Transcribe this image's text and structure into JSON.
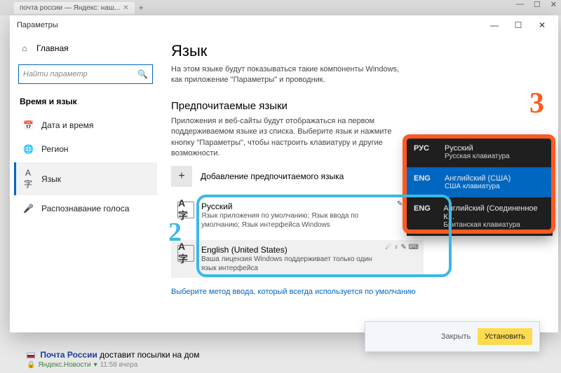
{
  "browser": {
    "tab_title": "почта россии — Яндекс: наш...",
    "controls": {
      "min": "—",
      "max": "☐",
      "close": "✕"
    }
  },
  "window": {
    "title": "Параметры",
    "controls": {
      "min": "—",
      "max": "☐",
      "close": "✕"
    }
  },
  "sidebar": {
    "home": "Главная",
    "search_placeholder": "Найти параметр",
    "section": "Время и язык",
    "items": [
      {
        "icon": "📅",
        "label": "Дата и время"
      },
      {
        "icon": "🌐",
        "label": "Регион"
      },
      {
        "icon": "A字",
        "label": "Язык"
      },
      {
        "icon": "🎤",
        "label": "Распознавание голоса"
      }
    ]
  },
  "content": {
    "title": "Язык",
    "desc": "На этом языке будут показываться такие компоненты Windows, как приложение \"Параметры\" и проводник.",
    "pref_title": "Предпочитаемые языки",
    "pref_desc": "Приложения и веб-сайты будут отображаться на первом поддерживаемом языке из списка. Выберите язык и нажмите кнопку \"Параметры\", чтобы настроить клавиатуру и другие возможности.",
    "add_label": "Добавление предпочитаемого языка",
    "langs": [
      {
        "glyph": "A字",
        "name": "Русский",
        "sub": "Язык приложения по умолчанию; Язык ввода по умолчанию; Язык интерфейса Windows",
        "icons": "✎ ♀ 🖵"
      },
      {
        "glyph": "A字",
        "name": "English (United States)",
        "sub": "Ваша лицензия Windows поддерживает только один язык интерфейса",
        "icons": "☄ ♀ ✎ ⌨"
      }
    ],
    "link": "Выберите метод ввода, который всегда используется по умолчанию"
  },
  "ime": {
    "rows": [
      {
        "code": "РУС",
        "l1": "Русский",
        "l2": "Русская клавиатура"
      },
      {
        "code": "ENG",
        "l1": "Английский (США)",
        "l2": "США клавиатура"
      },
      {
        "code": "ENG",
        "l1": "Английский (Соединенное К...",
        "l2": "Британская клавиатура"
      }
    ]
  },
  "annotations": {
    "two": "2",
    "three": "3"
  },
  "toast": {
    "close": "Закрыть",
    "install": "Установить"
  },
  "news": {
    "headline_bold": "Почта России",
    "headline_rest": " доставит посылки на дом",
    "source": "Яндекс.Новости",
    "time": "11:58 вчера"
  }
}
